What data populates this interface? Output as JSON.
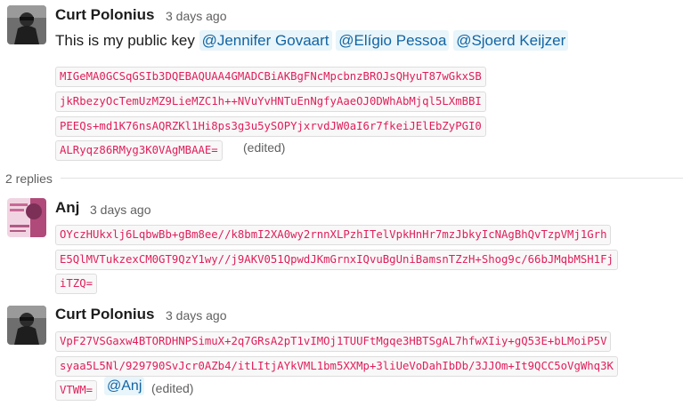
{
  "messages": [
    {
      "sender": "Curt Polonius",
      "time": "3 days ago",
      "text": "This is my public key",
      "mentions": [
        "@Jennifer Govaart",
        "@Elígio Pessoa",
        "@Sjoerd Keijzer"
      ],
      "code_lines": [
        "MIGeMA0GCSqGSIb3DQEBAQUAA4GMADCBiAKBgFNcMpcbnzBROJsQHyuT87wGkxSB",
        "jkRbezyOcTemUzMZ9LieMZC1h++NVuYvHNTuEnNgfyAaeOJ0DWhAbMjql5LXmBBI",
        "PEEQs+md1K76nsAQRZKl1Hi8ps3g3u5ySOPYjxrvdJW0aI6r7fkeiJElEbZyPGI0",
        "ALRyqz86RMyg3K0VAgMBAAE="
      ],
      "edited": "(edited)"
    },
    {
      "sender": "Anj",
      "time": "3 days ago",
      "code_lines": [
        "OYczHUkxlj6LqbwBb+gBm8ee//k8bmI2XA0wy2rnnXLPzhITelVpkHnHr7mzJbkyIcNAgBhQvTzpVMj1Grh",
        "E5QlMVTukzexCM0GT9QzY1wy//j9AKV051QpwdJKmGrnxIQvuBgUniBamsnTZzH+Shog9c/66bJMqbMSH1Fj",
        "iTZQ="
      ]
    },
    {
      "sender": "Curt Polonius",
      "time": "3 days ago",
      "code_lines": [
        "VpF27VSGaxw4BTORDHNPSimuX+2q7GRsA2pT1vIMOj1TUUFtMgqe3HBTSgAL7hfwXIiy+gQ53E+bLMoiP5V",
        "syaa5L5Nl/929790SvJcr0AZb4/itLItjAYkVML1bm5XXMp+3liUeVoDahIbDb/3JJOm+It9QCC5oVgWhq3K",
        "VTWM="
      ],
      "mention": "@Anj",
      "edited": "(edited)"
    }
  ],
  "thread": {
    "replies_label": "2 replies"
  }
}
